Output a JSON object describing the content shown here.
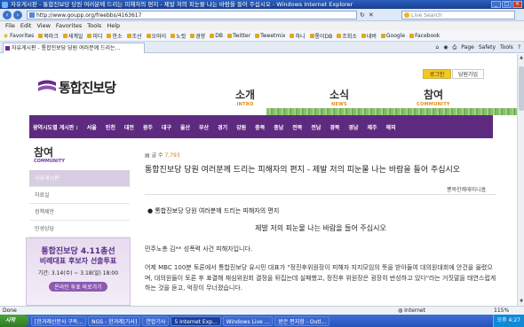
{
  "window": {
    "title": "자유게시판 - 통합진보당 당원 여러분께 드리는 피해자의 편지 - 제발 저의 피눈물 나는 바람을 들어 주십시오 - Windows Internet Explorer"
  },
  "address_bar": {
    "url": "http://www.goupp.org/freebbs/4163617",
    "search_placeholder": "Live Search"
  },
  "menu": [
    "File",
    "Edit",
    "View",
    "Favorites",
    "Tools",
    "Help"
  ],
  "favorites_bar": {
    "label": "Favorites",
    "items": [
      "북마크",
      "세계일",
      "미디",
      "한소",
      "조선",
      "오마이",
      "노컷",
      "경향",
      "DB",
      "Twitter",
      "Tweetmix",
      "하니",
      "통이DB",
      "조회소",
      "네버",
      "Google",
      "Facebook"
    ]
  },
  "tab": {
    "label": "자유게시판 - 통합진보당 당원 여러분께 드리는...",
    "tools": [
      "Page",
      "Safety",
      "Tools"
    ]
  },
  "site": {
    "logo": "통합진보당",
    "login": "로그인",
    "join": "당원가입",
    "nav": [
      {
        "ko": "소개",
        "en": "INTRO"
      },
      {
        "ko": "소식",
        "en": "NEWS"
      },
      {
        "ko": "참여",
        "en": "COMMUNITY"
      }
    ],
    "region_label": "광역시도별 게시판 :",
    "regions": [
      "서울",
      "인천",
      "대전",
      "광주",
      "대구",
      "울산",
      "부산",
      "경기",
      "강원",
      "충북",
      "충남",
      "전북",
      "전남",
      "경북",
      "경남",
      "제주",
      "해외"
    ],
    "side_title": "참여",
    "side_sub": "COMMUNITY",
    "side_menu": [
      "자유게시판",
      "자료실",
      "정책제안",
      "민생상담"
    ],
    "promo": {
      "line1": "통합진보당 4.11총선",
      "line2": "비례대표 후보자 선출투표",
      "line3": "기간: 3.14(수) ~ 3.18(일) 18:00",
      "button": "온라인 투표 바로가기"
    }
  },
  "post": {
    "views_label": "글 수",
    "views": "7,793",
    "title": "통합진보당 당원 여러분께 드리는 피해자의 편지 - 제발 저의 피눈물 나는 바람을 들어 주십시오",
    "author": "뽕복한쾌때미니홉",
    "subtitle": "● 통합진보당 당원 여러분께 드리는 피해자의 편지",
    "center_title": "제발 저의 피눈물 나는 바람을 들어 주십시오",
    "para1": "민주노총 김** 성폭력 사건 피해자입니다.",
    "para2": "어제 MBC 100분 토론에서 통합진보당 유시민 대표가 \"정진후위원장이 피해자 지지모임의 뜻을 받아들여 대의원대회에 안건을 올렸으며, 대의원들이 토론 후 표결해 재심위원회 결정을 뒤집는데 실패했고, 정진후 위원장은 굉장히 반성하고 있다\"라는 거짓말을 태연스럽게 하는 것을 듣고, 억장이 무너졌습니다."
  },
  "statusbar": {
    "left": "Done",
    "zone": "Internet",
    "zoom": "115%"
  },
  "taskbar": {
    "start": "시작",
    "tasks": [
      "[한겨레신문사 구독...",
      "NGS - 한겨레[기사]",
      "연합기사",
      "5 Internet Exp...",
      "Windows Live ...",
      "받은 편지함 - Outl..."
    ],
    "clock": "오후 4:27"
  }
}
